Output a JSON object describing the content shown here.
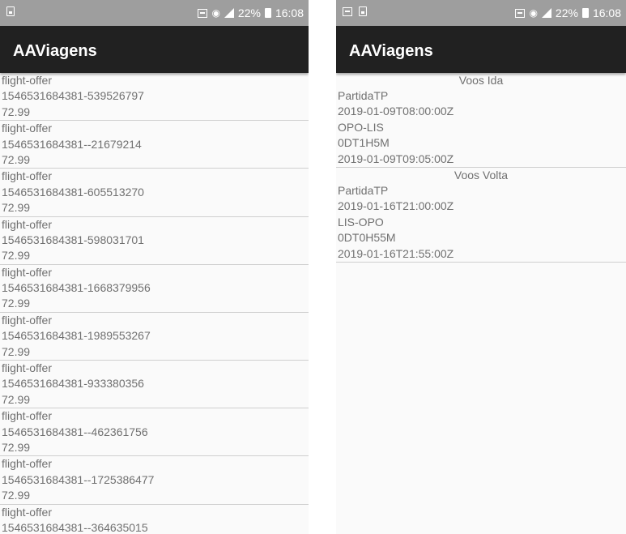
{
  "status_bar": {
    "battery": "22%",
    "time": "16:08"
  },
  "app": {
    "title": "AAViagens"
  },
  "offers": [
    {
      "type": "flight-offer",
      "id": "1546531684381-539526797",
      "price": "72.99"
    },
    {
      "type": "flight-offer",
      "id": "1546531684381--21679214",
      "price": "72.99"
    },
    {
      "type": "flight-offer",
      "id": "1546531684381-605513270",
      "price": "72.99"
    },
    {
      "type": "flight-offer",
      "id": "1546531684381-598031701",
      "price": "72.99"
    },
    {
      "type": "flight-offer",
      "id": "1546531684381-1668379956",
      "price": "72.99"
    },
    {
      "type": "flight-offer",
      "id": "1546531684381-1989553267",
      "price": "72.99"
    },
    {
      "type": "flight-offer",
      "id": "1546531684381-933380356",
      "price": "72.99"
    },
    {
      "type": "flight-offer",
      "id": "1546531684381--462361756",
      "price": "72.99"
    },
    {
      "type": "flight-offer",
      "id": "1546531684381--1725386477",
      "price": "72.99"
    },
    {
      "type": "flight-offer",
      "id": "1546531684381--364635015",
      "price": ""
    }
  ],
  "detail": {
    "outbound": {
      "title": "Voos Ida",
      "carrier": "PartidaTP",
      "departure": "2019-01-09T08:00:00Z",
      "route": "OPO-LIS",
      "duration": "0DT1H5M",
      "arrival": "2019-01-09T09:05:00Z"
    },
    "return": {
      "title": "Voos Volta",
      "carrier": "PartidaTP",
      "departure": "2019-01-16T21:00:00Z",
      "route": "LIS-OPO",
      "duration": "0DT0H55M",
      "arrival": "2019-01-16T21:55:00Z"
    }
  },
  "colors": {
    "status_bar": "#9e9e9e",
    "app_bar": "#212121",
    "text": "#707070",
    "divider": "#cfcfcf"
  }
}
